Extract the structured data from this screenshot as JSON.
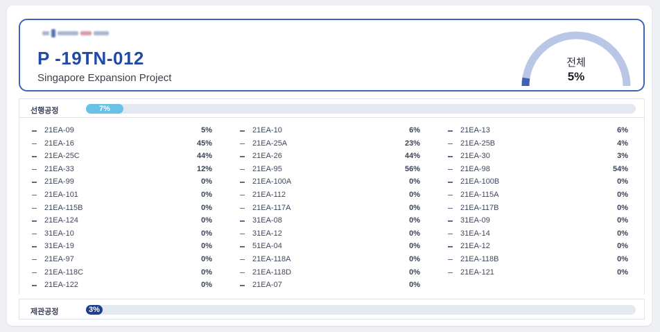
{
  "project": {
    "code": "P -19TN-012",
    "name": "Singapore Expansion Project"
  },
  "overall": {
    "label": "전체",
    "value_text": "5%",
    "progress": 0.05,
    "arc_color": "#b9c6e6",
    "arc_fill_color": "#3d62b8"
  },
  "sections": {
    "advance": {
      "label": "선행공정",
      "value_text": "7%",
      "progress": 0.07,
      "color": "#6ac1e8"
    },
    "final": {
      "label": "제관공정",
      "value_text": "3%",
      "progress": 0.03,
      "color": "#1f3f8a"
    }
  },
  "items": {
    "col1": [
      {
        "name": "21EA-09",
        "pct": "5%"
      },
      {
        "name": "21EA-16",
        "pct": "45%"
      },
      {
        "name": "21EA-25C",
        "pct": "44%"
      },
      {
        "name": "21EA-33",
        "pct": "12%"
      },
      {
        "name": "21EA-99",
        "pct": "0%"
      },
      {
        "name": "21EA-101",
        "pct": "0%"
      },
      {
        "name": "21EA-115B",
        "pct": "0%"
      },
      {
        "name": "21EA-124",
        "pct": "0%"
      },
      {
        "name": "31EA-10",
        "pct": "0%"
      },
      {
        "name": "31EA-19",
        "pct": "0%"
      },
      {
        "name": "21EA-97",
        "pct": "0%"
      },
      {
        "name": "21EA-118C",
        "pct": "0%"
      },
      {
        "name": "21EA-122",
        "pct": "0%"
      }
    ],
    "col2": [
      {
        "name": "21EA-10",
        "pct": "6%"
      },
      {
        "name": "21EA-25A",
        "pct": "23%"
      },
      {
        "name": "21EA-26",
        "pct": "44%"
      },
      {
        "name": "21EA-95",
        "pct": "56%"
      },
      {
        "name": "21EA-100A",
        "pct": "0%"
      },
      {
        "name": "21EA-112",
        "pct": "0%"
      },
      {
        "name": "21EA-117A",
        "pct": "0%"
      },
      {
        "name": "31EA-08",
        "pct": "0%"
      },
      {
        "name": "31EA-12",
        "pct": "0%"
      },
      {
        "name": "51EA-04",
        "pct": "0%"
      },
      {
        "name": "21EA-118A",
        "pct": "0%"
      },
      {
        "name": "21EA-118D",
        "pct": "0%"
      },
      {
        "name": "21EA-07",
        "pct": "0%"
      }
    ],
    "col3": [
      {
        "name": "21EA-13",
        "pct": "6%"
      },
      {
        "name": "21EA-25B",
        "pct": "4%"
      },
      {
        "name": "21EA-30",
        "pct": "3%"
      },
      {
        "name": "21EA-98",
        "pct": "54%"
      },
      {
        "name": "21EA-100B",
        "pct": "0%"
      },
      {
        "name": "21EA-115A",
        "pct": "0%"
      },
      {
        "name": "21EA-117B",
        "pct": "0%"
      },
      {
        "name": "31EA-09",
        "pct": "0%"
      },
      {
        "name": "31EA-14",
        "pct": "0%"
      },
      {
        "name": "21EA-12",
        "pct": "0%"
      },
      {
        "name": "21EA-118B",
        "pct": "0%"
      },
      {
        "name": "21EA-121",
        "pct": "0%"
      }
    ]
  }
}
